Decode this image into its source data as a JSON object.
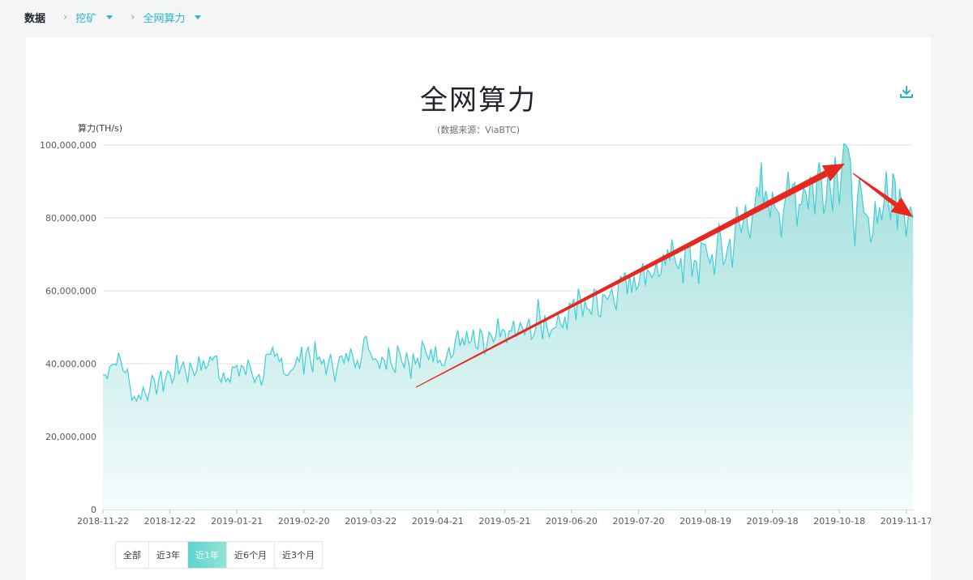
{
  "breadcrumb": {
    "root": "数据",
    "level1": "挖矿",
    "level2": "全网算力"
  },
  "colors": {
    "accent": "#2ab5c6",
    "line": "#3ecfd6",
    "area_top": "#a7e0de",
    "arrow": "#e8281f"
  },
  "range_buttons": [
    "全部",
    "近3年",
    "近1年",
    "近6个月",
    "近3个月"
  ],
  "range_selected": "近1年",
  "chart_data": {
    "type": "area",
    "title": "全网算力",
    "subtitle": "(数据来源：ViaBTC)",
    "ylabel": "算力(TH/s)",
    "ylim": [
      0,
      100000000
    ],
    "yticks": [
      "0",
      "20,000,000",
      "40,000,000",
      "60,000,000",
      "80,000,000",
      "100,000,000"
    ],
    "xticks": [
      "2018-11-22",
      "2018-12-22",
      "2019-01-21",
      "2019-02-20",
      "2019-03-22",
      "2019-04-21",
      "2019-05-21",
      "2019-06-20",
      "2019-07-20",
      "2019-08-19",
      "2019-09-18",
      "2019-10-18",
      "2019-11-17"
    ],
    "grid": true,
    "series": [
      {
        "x": [
          "2018-11-22",
          "2018-11-29",
          "2018-12-06",
          "2018-12-13",
          "2018-12-20",
          "2018-12-27",
          "2019-01-03",
          "2019-01-10",
          "2019-01-17",
          "2019-01-24",
          "2019-01-31",
          "2019-02-07",
          "2019-02-14",
          "2019-02-21",
          "2019-02-28",
          "2019-03-07",
          "2019-03-14",
          "2019-03-21",
          "2019-03-28",
          "2019-04-04",
          "2019-04-11",
          "2019-04-18",
          "2019-04-25",
          "2019-05-02",
          "2019-05-09",
          "2019-05-16",
          "2019-05-23",
          "2019-05-30",
          "2019-06-06",
          "2019-06-13",
          "2019-06-20",
          "2019-06-27",
          "2019-07-04",
          "2019-07-11",
          "2019-07-18",
          "2019-07-25",
          "2019-08-01",
          "2019-08-08",
          "2019-08-15",
          "2019-08-22",
          "2019-08-29",
          "2019-09-05",
          "2019-09-12",
          "2019-09-19",
          "2019-09-26",
          "2019-10-03",
          "2019-10-10",
          "2019-10-17",
          "2019-10-21",
          "2019-10-24",
          "2019-10-31",
          "2019-11-07",
          "2019-11-14",
          "2019-11-20"
        ],
        "values": [
          37000000,
          43000000,
          31000000,
          33000000,
          36000000,
          39000000,
          38000000,
          41000000,
          36000000,
          39000000,
          37000000,
          42000000,
          38000000,
          43000000,
          40000000,
          39000000,
          42000000,
          44000000,
          41000000,
          43000000,
          40000000,
          44000000,
          42000000,
          47000000,
          44000000,
          46000000,
          49000000,
          48000000,
          52000000,
          50000000,
          56000000,
          55000000,
          59000000,
          62000000,
          64000000,
          65000000,
          67000000,
          69000000,
          68000000,
          70000000,
          72000000,
          79000000,
          86000000,
          83000000,
          86000000,
          87000000,
          90000000,
          92000000,
          100000000,
          82000000,
          80000000,
          84000000,
          88000000,
          80000000
        ]
      }
    ],
    "annotations": [
      "trend-arrow-up",
      "trend-arrow-down"
    ]
  }
}
